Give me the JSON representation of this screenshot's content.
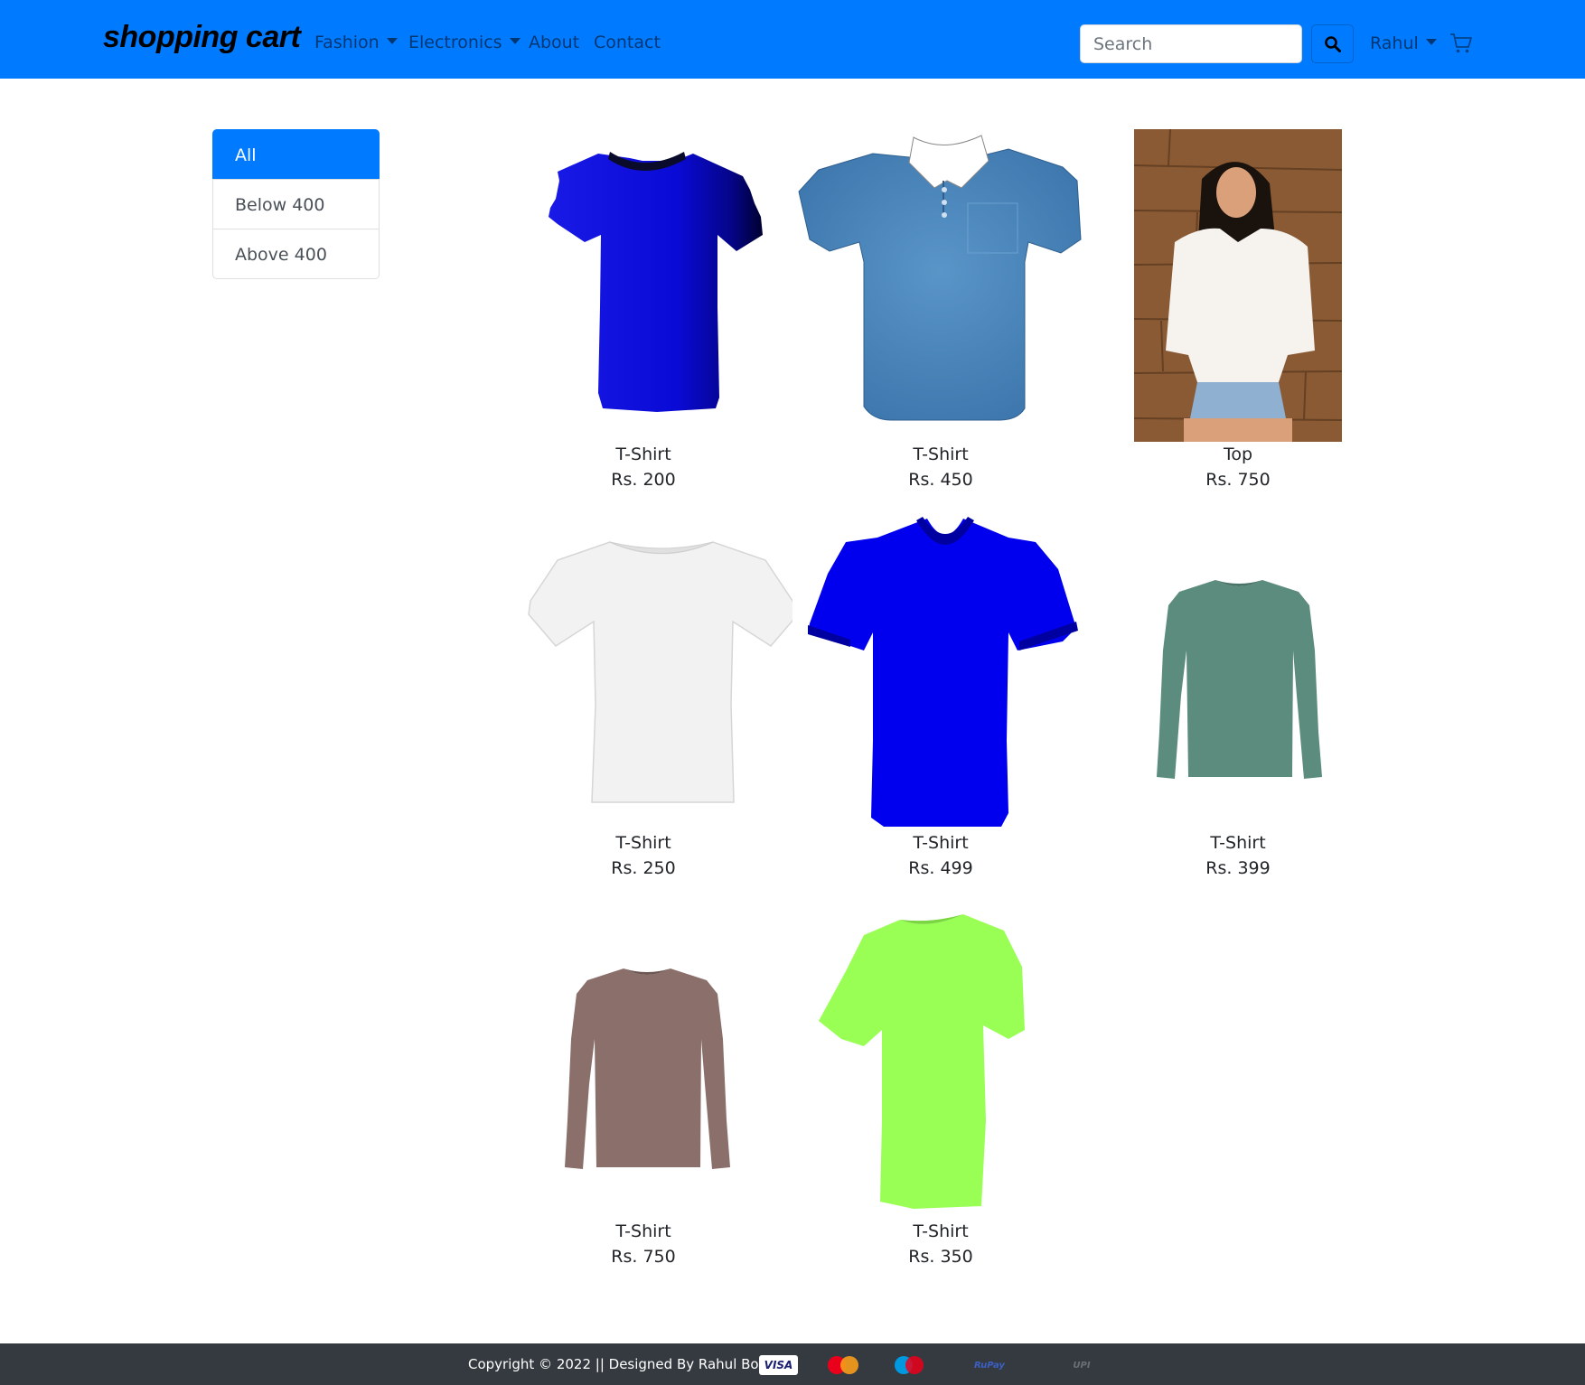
{
  "navbar": {
    "brand": "shopping cart",
    "links": [
      {
        "label": "Fashion"
      },
      {
        "label": "Electronics"
      },
      {
        "label": "About"
      },
      {
        "label": "Contact"
      }
    ],
    "search_placeholder": "Search",
    "user": "Rahul",
    "accent_color": "#007bff"
  },
  "sidebar": {
    "items": [
      {
        "label": "All",
        "active": true
      },
      {
        "label": "Below 400"
      },
      {
        "label": "Above 400"
      }
    ]
  },
  "products": [
    {
      "name": "T-Shirt",
      "price": "Rs. 200"
    },
    {
      "name": "T-Shirt",
      "price": "Rs. 450"
    },
    {
      "name": "Top",
      "price": "Rs. 750"
    },
    {
      "name": "T-Shirt",
      "price": "Rs. 250"
    },
    {
      "name": "T-Shirt",
      "price": "Rs. 499"
    },
    {
      "name": "T-Shirt",
      "price": "Rs. 399"
    },
    {
      "name": "T-Shirt",
      "price": "Rs. 750"
    },
    {
      "name": "T-Shirt",
      "price": "Rs. 350"
    }
  ],
  "footer": {
    "copyright": "Copyright © 2022 || Designed By Rahul Bose ||",
    "payment_methods": [
      "VISA",
      "MasterCard",
      "Maestro",
      "RuPay",
      "UPI"
    ]
  }
}
